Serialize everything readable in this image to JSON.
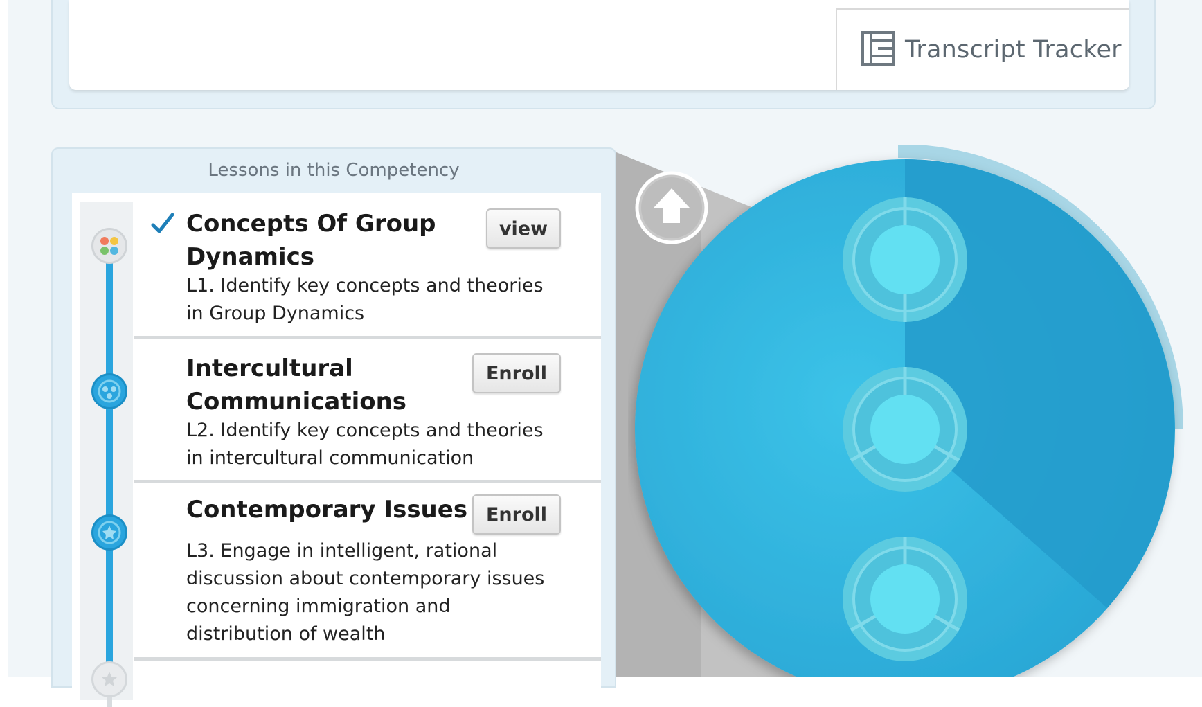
{
  "top": {
    "card_text": "",
    "transcript_tracker_label": "Transcript Tracker"
  },
  "lessons_panel": {
    "title": "Lessons in this Competency",
    "lessons": [
      {
        "title": "Concepts Of Group Dynamics",
        "description": "L1. Identify key concepts and theories in Group Dynamics",
        "button_label": "view",
        "completed": true
      },
      {
        "title": "Intercultural Communications",
        "description": "L2. Identify key concepts and theories in intercultural communication",
        "button_label": "Enroll",
        "completed": false
      },
      {
        "title": "Contemporary Issues",
        "description": "L3. Engage in intelligent, rational discussion about contemporary issues concerning immigration and distribution of wealth",
        "button_label": "Enroll",
        "completed": false
      }
    ]
  },
  "icons": {
    "transcript": "transcript-tracker-icon",
    "check": "checkmark-icon",
    "up_arrow": "up-arrow-icon"
  },
  "colors": {
    "accent_blue": "#2aa5de",
    "circle_blue": "#35b8e0",
    "circle_dark": "#229ccd",
    "ring_teal": "#5fd0e4",
    "check_blue": "#1e7fb8"
  }
}
